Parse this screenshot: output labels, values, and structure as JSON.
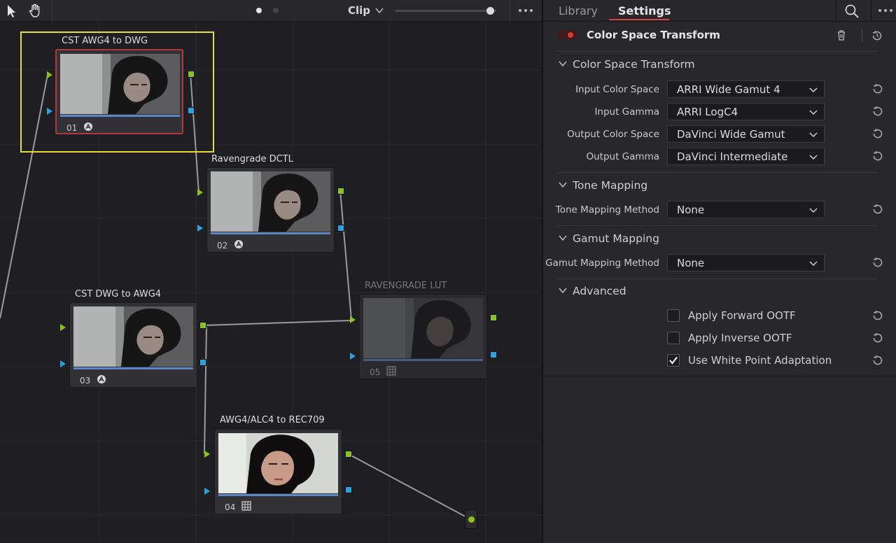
{
  "toolbar": {
    "pointer_tool": "pointer-icon",
    "hand_tool": "hand-icon",
    "mode_label": "Clip",
    "zoom_level": 0.98,
    "more_icon": "more-icon"
  },
  "nodes": [
    {
      "num": "01",
      "label": "CST AWG4 to DWG",
      "icon": "fx-icon",
      "selected": true
    },
    {
      "num": "02",
      "label": "Ravengrade DCTL",
      "icon": "fx-icon",
      "selected": false
    },
    {
      "num": "03",
      "label": "CST DWG to AWG4",
      "icon": "fx-icon",
      "selected": false
    },
    {
      "num": "05",
      "label": "RAVENGRADE LUT",
      "icon": "lut-grid-icon",
      "selected": false,
      "disabled": true
    },
    {
      "num": "04",
      "label": "AWG4/ALC4 to REC709",
      "icon": "lut-grid-icon",
      "selected": false
    }
  ],
  "panel": {
    "tabs": [
      {
        "label": "Library",
        "active": false
      },
      {
        "label": "Settings",
        "active": true
      }
    ],
    "effect_title": "Color Space Transform",
    "effect_enabled": true,
    "sections": {
      "cst": {
        "title": "Color Space Transform",
        "rows": [
          {
            "label": "Input Color Space",
            "value": "ARRI Wide Gamut 4"
          },
          {
            "label": "Input Gamma",
            "value": "ARRI LogC4"
          },
          {
            "label": "Output Color Space",
            "value": "DaVinci Wide Gamut"
          },
          {
            "label": "Output Gamma",
            "value": "DaVinci Intermediate"
          }
        ]
      },
      "tone": {
        "title": "Tone Mapping",
        "rows": [
          {
            "label": "Tone Mapping Method",
            "value": "None"
          }
        ]
      },
      "gamut": {
        "title": "Gamut Mapping",
        "rows": [
          {
            "label": "Gamut Mapping Method",
            "value": "None"
          }
        ]
      },
      "advanced": {
        "title": "Advanced",
        "checks": [
          {
            "label": "Apply Forward OOTF",
            "checked": false
          },
          {
            "label": "Apply Inverse OOTF",
            "checked": false
          },
          {
            "label": "Use White Point Adaptation",
            "checked": true
          }
        ]
      }
    }
  },
  "colors": {
    "accent_red": "#d0443c",
    "selection_yellow": "#e7e02a",
    "rgb_port_green": "#8cc21c",
    "alpha_port_blue": "#27a3df"
  }
}
